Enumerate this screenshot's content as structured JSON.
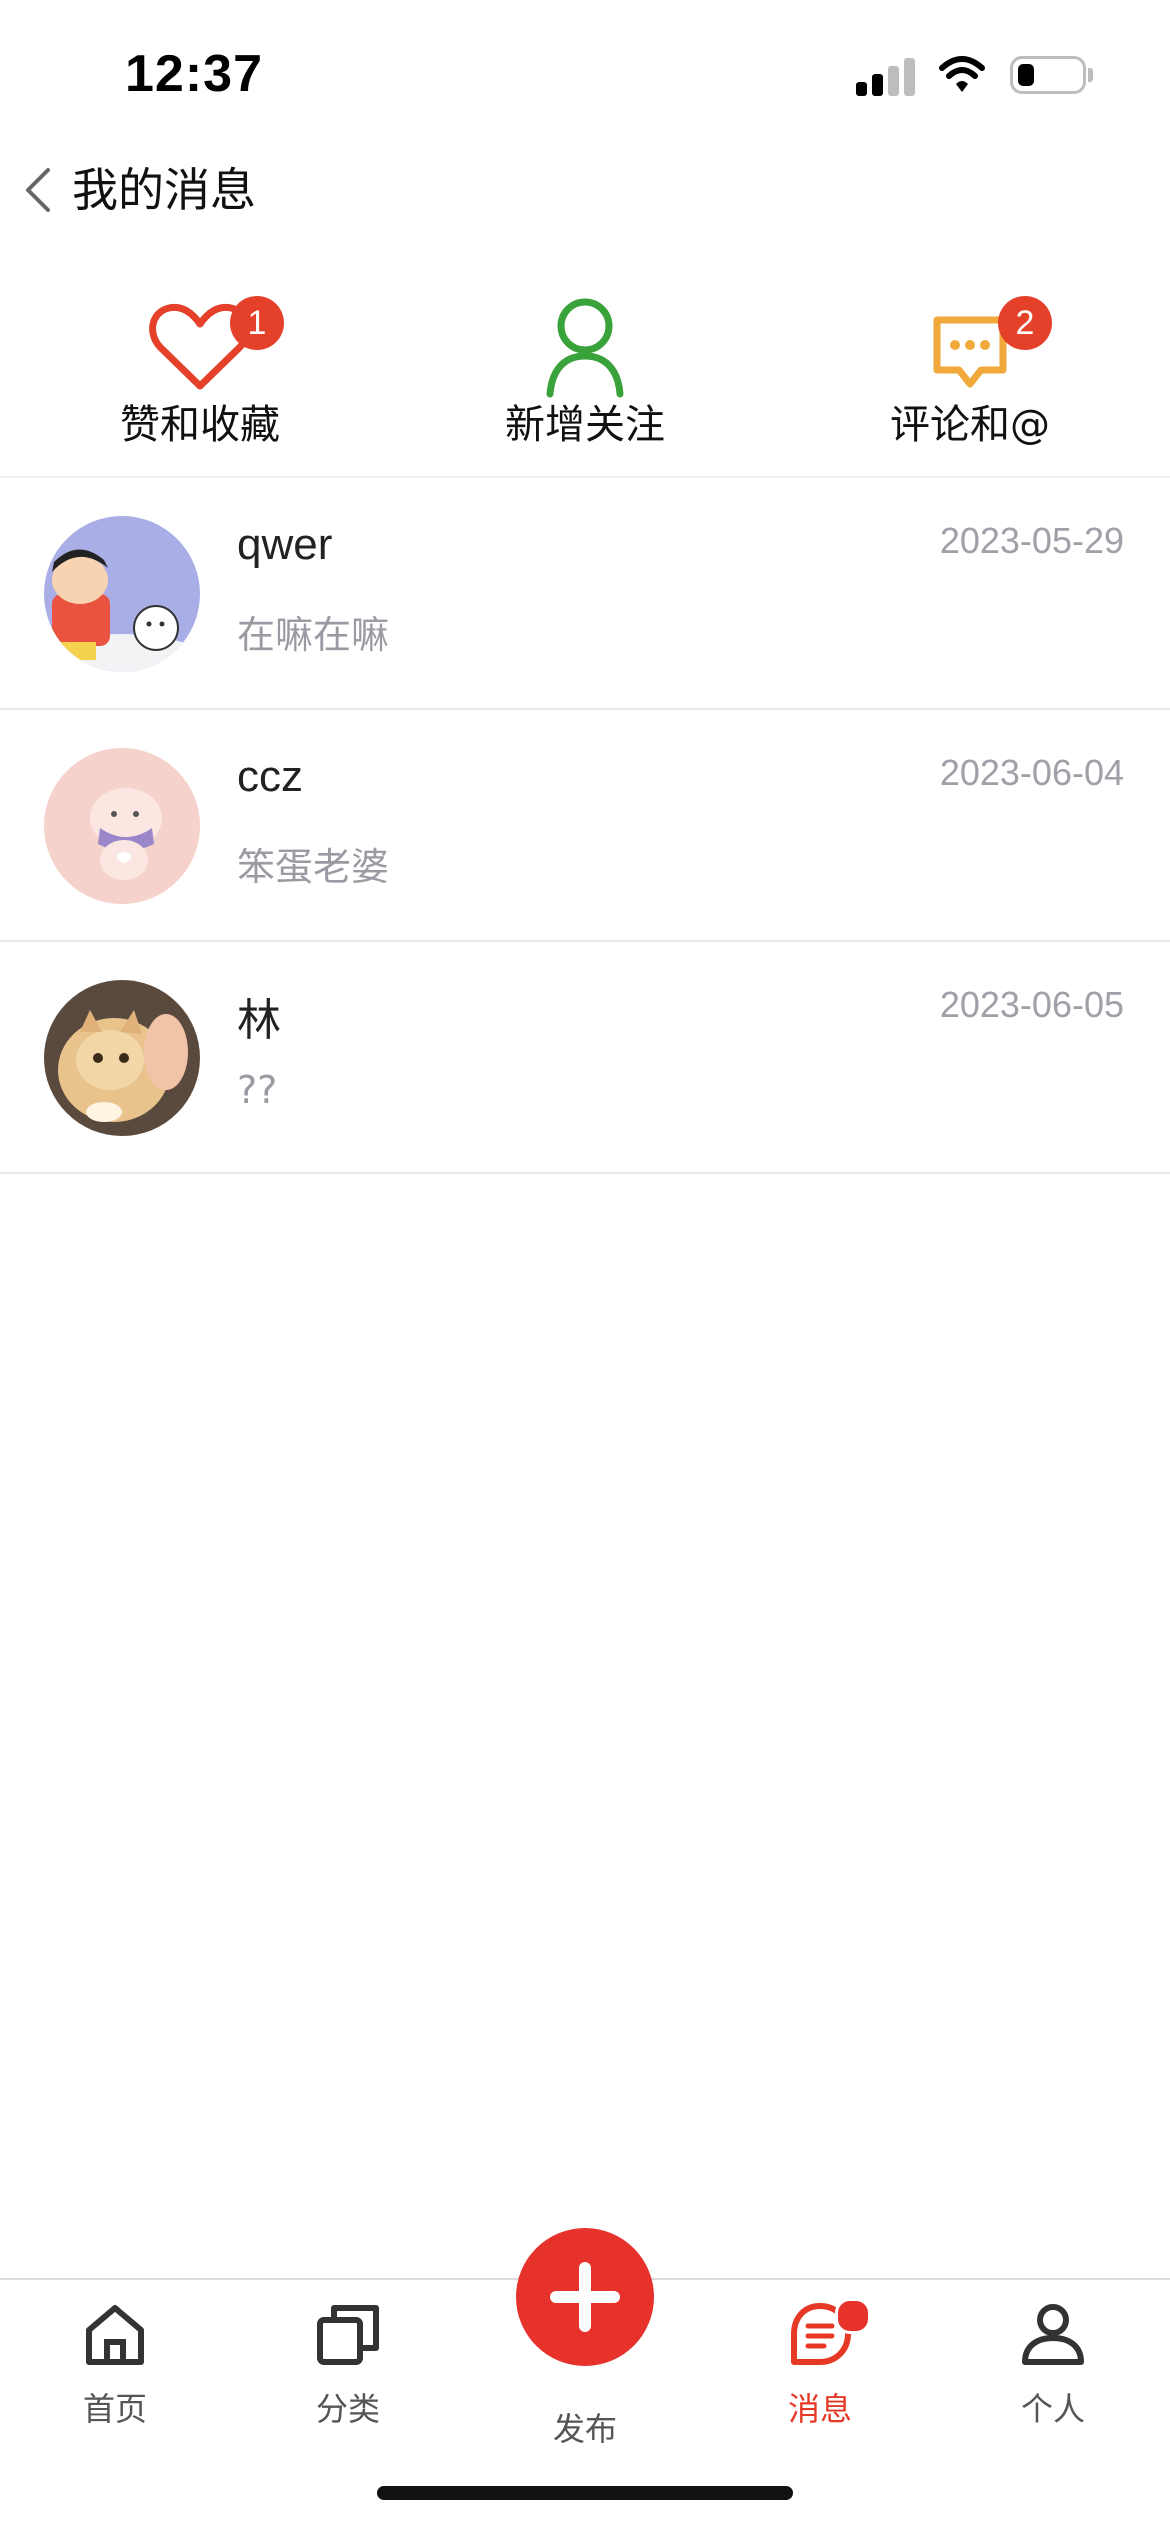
{
  "status_bar": {
    "time": "12:37"
  },
  "header": {
    "title": "我的消息"
  },
  "categories": [
    {
      "label": "赞和收藏",
      "icon": "heart-icon",
      "badge": "1",
      "color": "#e5412a"
    },
    {
      "label": "新增关注",
      "icon": "user-icon",
      "badge": "",
      "color": "#3aa23a"
    },
    {
      "label": "评论和@",
      "icon": "comment-icon",
      "badge": "2",
      "color": "#f2a93b"
    }
  ],
  "messages": [
    {
      "name": "qwer",
      "preview": "在嘛在嘛",
      "date": "2023-05-29"
    },
    {
      "name": "ccz",
      "preview": "笨蛋老婆",
      "date": "2023-06-04"
    },
    {
      "name": "林",
      "preview": "??",
      "date": "2023-06-05"
    }
  ],
  "tab_bar": {
    "items": [
      {
        "label": "首页",
        "icon": "home-icon"
      },
      {
        "label": "分类",
        "icon": "category-icon"
      },
      {
        "label": "发布",
        "icon": "plus-icon"
      },
      {
        "label": "消息",
        "icon": "message-icon",
        "active": true,
        "has_dot": true
      },
      {
        "label": "个人",
        "icon": "profile-icon"
      }
    ]
  },
  "colors": {
    "accent": "#e6322a",
    "muted_text": "#9a9aa2"
  }
}
